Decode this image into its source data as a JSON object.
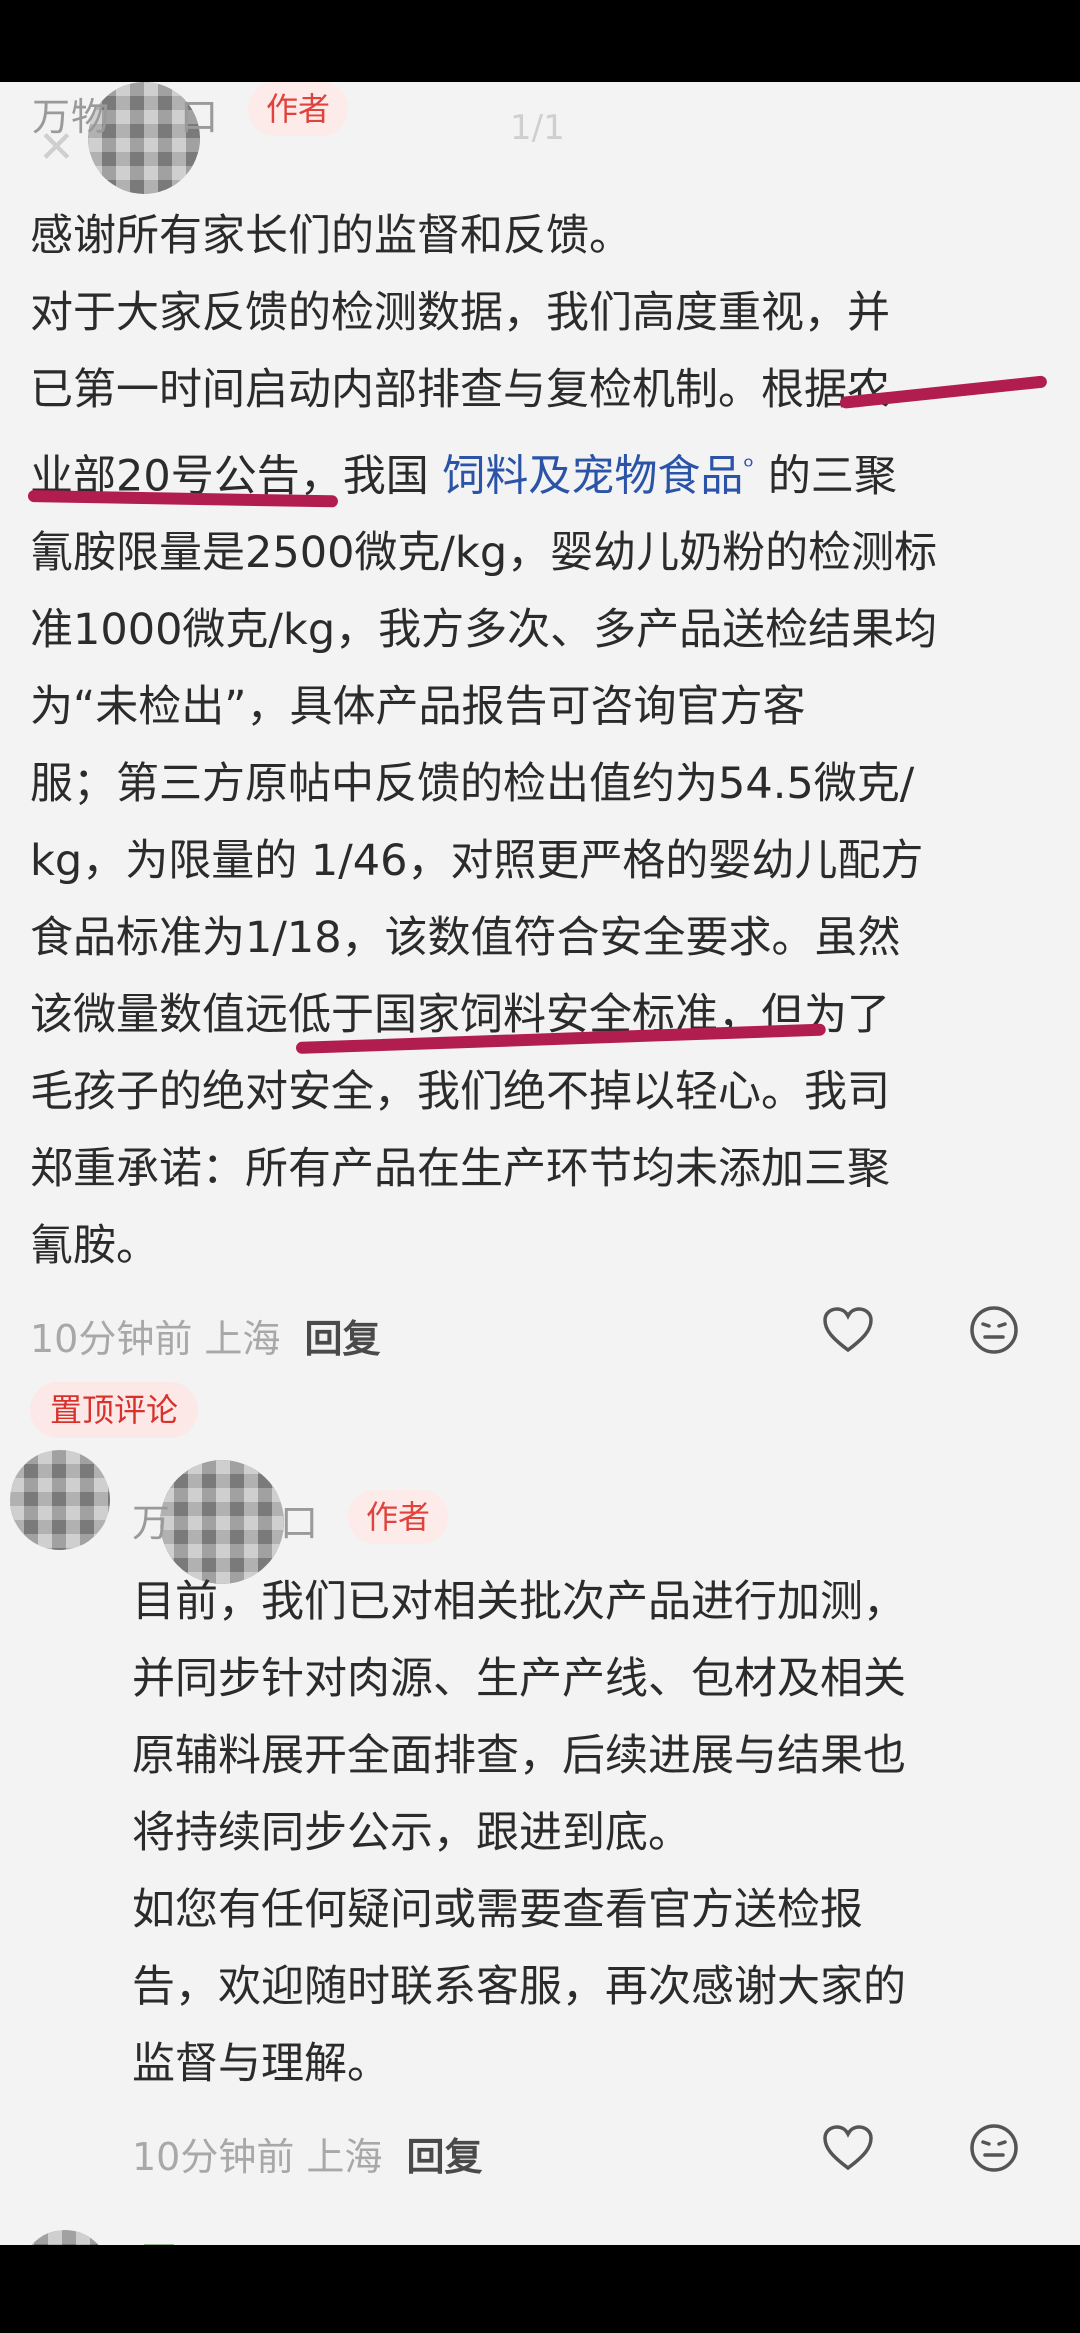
{
  "image_viewer": {
    "counter": "1/1"
  },
  "comment_main": {
    "author_name": "万物",
    "author_name_suffix": "口",
    "author_tag": "作者",
    "lines": [
      "感谢所有家长们的监督和反馈。",
      "对于大家反馈的检测数据，我们高度重视，并",
      "已第一时间启动内部排查与复检机制。根据农"
    ],
    "line4_a": "业部20号公告，我国 ",
    "line4_link": "饲料及宠物食品",
    "line4_b": " 的三聚",
    "lines_rest": [
      "氰胺限量是2500微克/kg，婴幼儿奶粉的检测标",
      "准1000微克/kg，我方多次、多产品送检结果均",
      "为“未检出”，具体产品报告可咨询官方客",
      "服；第三方原帖中反馈的检出值约为54.5微克/",
      "kg，为限量的 1/46，对照更严格的婴幼儿配方",
      "食品标准为1/18，该数值符合安全要求。虽然",
      "该微量数值远低于国家饲料安全标准，但为了",
      "毛孩子的绝对安全，我们绝不掉以轻心。我司",
      "郑重承诺：所有产品在生产环节均未添加三聚",
      "氰胺。"
    ],
    "time": "10分钟前 上海",
    "reply_label": "回复"
  },
  "pinned_label": "置顶评论",
  "comment_reply": {
    "author_name": "万",
    "author_name_suffix": "口",
    "author_tag": "作者",
    "lines": [
      "目前，我们已对相关批次产品进行加测，",
      "并同步针对肉源、生产产线、包材及相关",
      "原辅料展开全面排查，后续进展与结果也",
      "将持续同步公示，跟进到底。",
      "如您有任何疑问或需要查看官方送检报",
      "告，欢迎随时联系客服，再次感谢大家的",
      "监督与理解。"
    ],
    "time": "10分钟前 上海",
    "reply_label": "回复"
  },
  "next_comment": {
    "author_name": "王"
  },
  "colors": {
    "tag_red": "#e2423c",
    "underline": "#b21d50",
    "link_blue": "#2b54a8"
  },
  "icons": [
    "back-arrow-icon",
    "heart-icon",
    "emoji-icon",
    "link-search-icon"
  ]
}
